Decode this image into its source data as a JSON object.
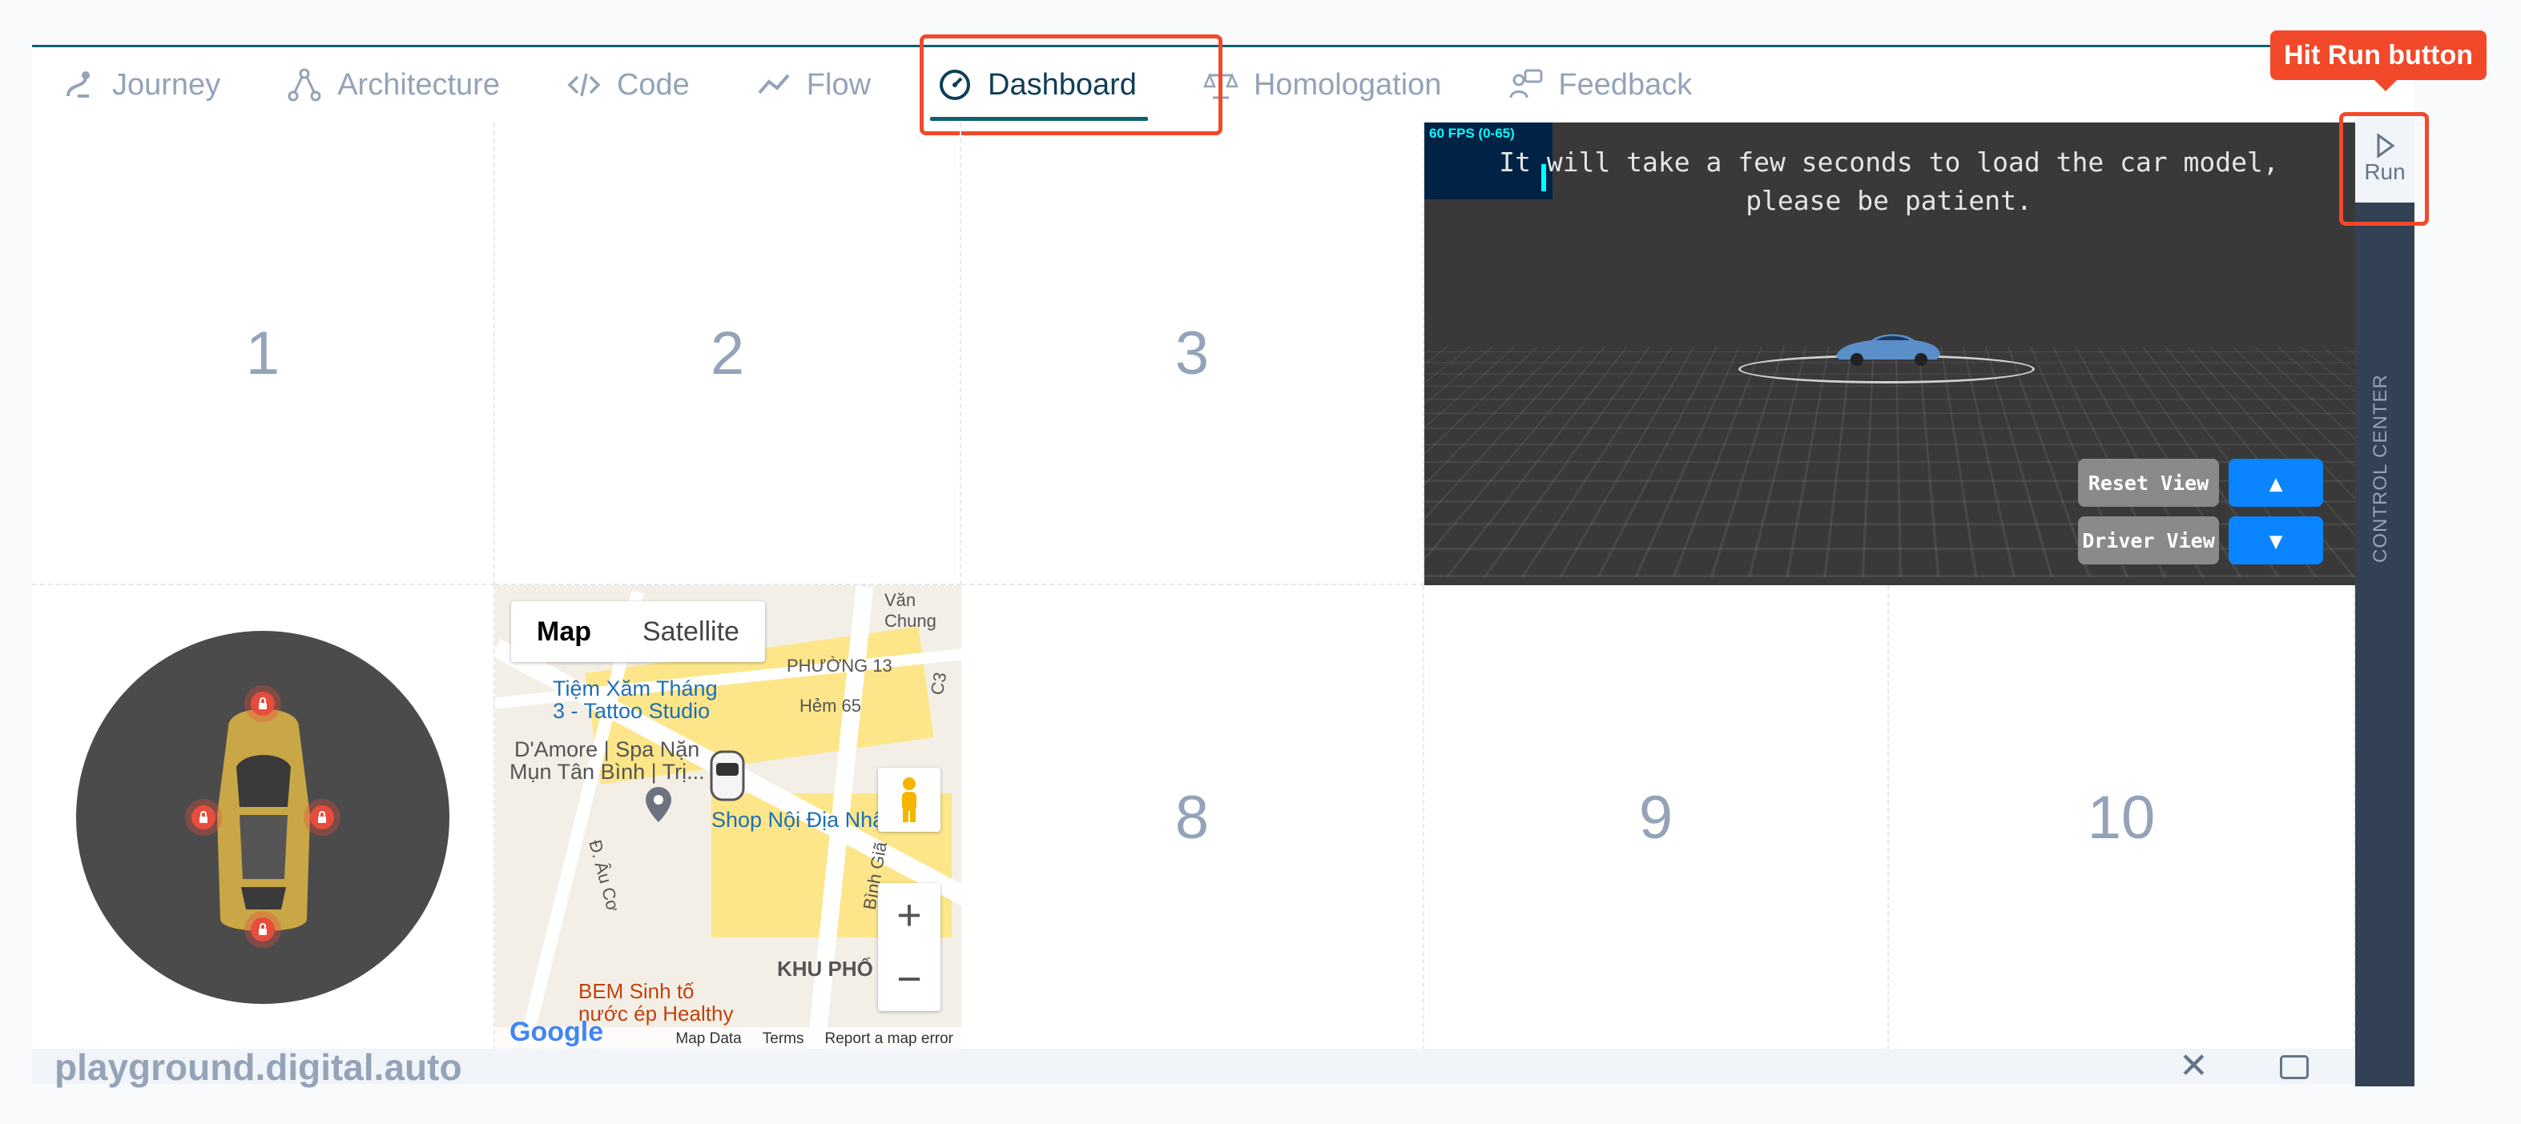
{
  "tabs": [
    {
      "label": "Journey",
      "icon": "journey-icon"
    },
    {
      "label": "Architecture",
      "icon": "architecture-icon"
    },
    {
      "label": "Code",
      "icon": "code-icon"
    },
    {
      "label": "Flow",
      "icon": "flow-icon"
    },
    {
      "label": "Dashboard",
      "icon": "dashboard-icon",
      "active": true
    },
    {
      "label": "Homologation",
      "icon": "homologation-icon"
    },
    {
      "label": "Feedback",
      "icon": "feedback-icon"
    }
  ],
  "cells": {
    "c1": "1",
    "c2": "2",
    "c3": "3",
    "c8": "8",
    "c9": "9",
    "c10": "10"
  },
  "viewer": {
    "fps": "60 FPS (0-65)",
    "message": "It will take a few seconds to load the car model, please be patient.",
    "reset_view": "Reset View",
    "driver_view": "Driver View",
    "up": "▲",
    "down": "▼"
  },
  "map": {
    "map_label": "Map",
    "satellite_label": "Satellite",
    "places": {
      "van_chung": "Văn Chung",
      "phuong13": "PHƯỜNG 13",
      "tattoo1": "Tiệm Xăm Tháng",
      "tattoo2": "3 - Tattoo Studio",
      "hem65": "Hẻm 65",
      "spa1": "D'Amore | Spa Nặn",
      "spa2": "Mụn Tân Bình | Trị...",
      "shop": "Shop Nội Địa Nhật",
      "au_co": "Đ. Âu Cơ",
      "binh_gia": "Bình Giã",
      "khu_pho": "KHU PHỐ",
      "bem1": "BEM Sinh tố",
      "bem2": "nước ép Healthy",
      "c3": "C3"
    },
    "google": "Google",
    "map_data": "Map Data",
    "terms": "Terms",
    "report": "Report a map error",
    "zoom_in": "+",
    "zoom_out": "−"
  },
  "control_center": {
    "label": "CONTROL CENTER",
    "run_label": "Run"
  },
  "tooltip": "Hit Run button",
  "footer": {
    "site": "playground.digital.auto",
    "close": "✕"
  },
  "colors": {
    "accent": "#0f5f70",
    "highlight": "#f2492a",
    "blue": "#0a84ff"
  }
}
